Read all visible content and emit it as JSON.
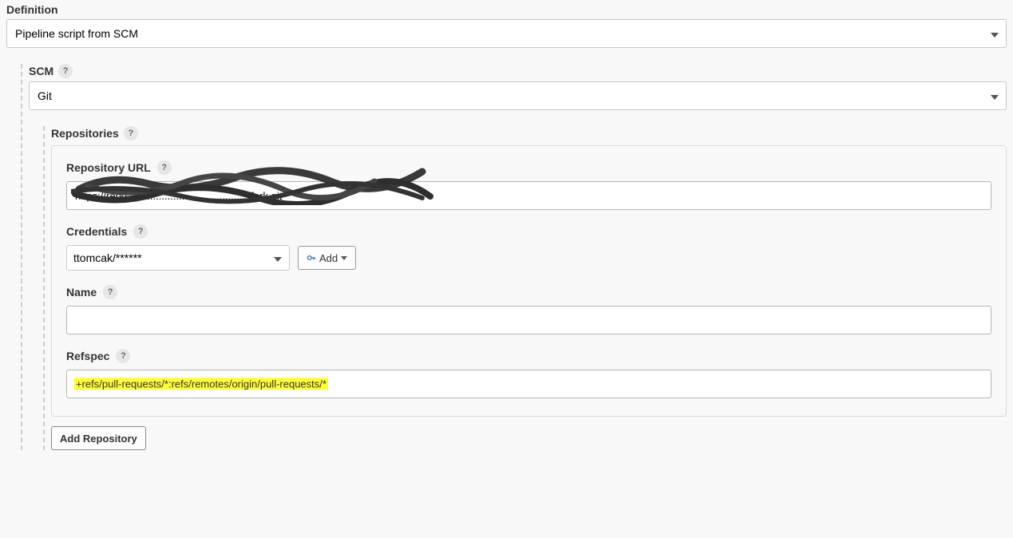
{
  "definition": {
    "label": "Definition",
    "selected": "Pipeline script from SCM"
  },
  "scm": {
    "label": "SCM",
    "selected": "Git"
  },
  "repositories": {
    "label": "Repositories",
    "repo_url_label": "Repository URL",
    "repo_url_value": "https://repo...........................................fork.git",
    "credentials_label": "Credentials",
    "credentials_selected": "ttomcak/******",
    "add_label": "Add",
    "name_label": "Name",
    "name_value": "",
    "refspec_label": "Refspec",
    "refspec_value": "+refs/pull-requests/*:refs/remotes/origin/pull-requests/*",
    "add_repo_label": "Add Repository"
  }
}
